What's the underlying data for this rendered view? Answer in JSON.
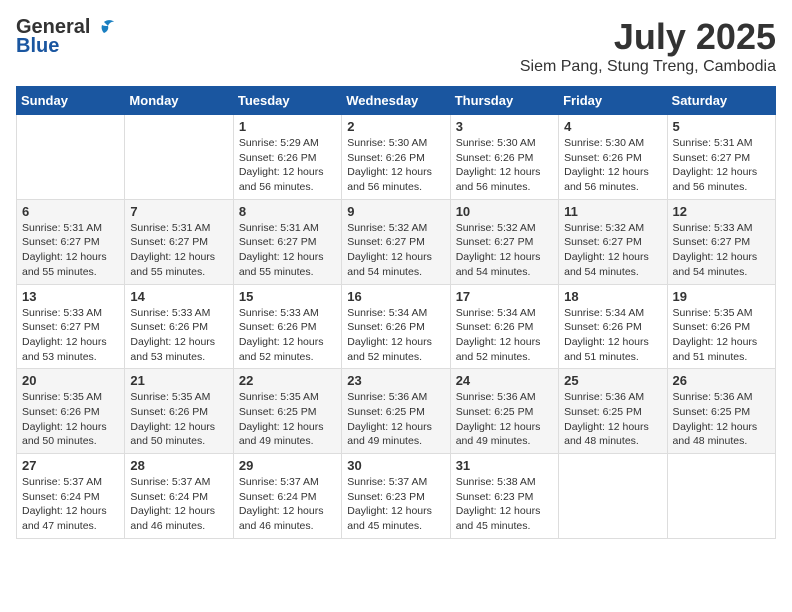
{
  "header": {
    "logo_general": "General",
    "logo_blue": "Blue",
    "title": "July 2025",
    "subtitle": "Siem Pang, Stung Treng, Cambodia"
  },
  "weekdays": [
    "Sunday",
    "Monday",
    "Tuesday",
    "Wednesday",
    "Thursday",
    "Friday",
    "Saturday"
  ],
  "weeks": [
    [
      {
        "day": "",
        "info": ""
      },
      {
        "day": "",
        "info": ""
      },
      {
        "day": "1",
        "info": "Sunrise: 5:29 AM\nSunset: 6:26 PM\nDaylight: 12 hours and 56 minutes."
      },
      {
        "day": "2",
        "info": "Sunrise: 5:30 AM\nSunset: 6:26 PM\nDaylight: 12 hours and 56 minutes."
      },
      {
        "day": "3",
        "info": "Sunrise: 5:30 AM\nSunset: 6:26 PM\nDaylight: 12 hours and 56 minutes."
      },
      {
        "day": "4",
        "info": "Sunrise: 5:30 AM\nSunset: 6:26 PM\nDaylight: 12 hours and 56 minutes."
      },
      {
        "day": "5",
        "info": "Sunrise: 5:31 AM\nSunset: 6:27 PM\nDaylight: 12 hours and 56 minutes."
      }
    ],
    [
      {
        "day": "6",
        "info": "Sunrise: 5:31 AM\nSunset: 6:27 PM\nDaylight: 12 hours and 55 minutes."
      },
      {
        "day": "7",
        "info": "Sunrise: 5:31 AM\nSunset: 6:27 PM\nDaylight: 12 hours and 55 minutes."
      },
      {
        "day": "8",
        "info": "Sunrise: 5:31 AM\nSunset: 6:27 PM\nDaylight: 12 hours and 55 minutes."
      },
      {
        "day": "9",
        "info": "Sunrise: 5:32 AM\nSunset: 6:27 PM\nDaylight: 12 hours and 54 minutes."
      },
      {
        "day": "10",
        "info": "Sunrise: 5:32 AM\nSunset: 6:27 PM\nDaylight: 12 hours and 54 minutes."
      },
      {
        "day": "11",
        "info": "Sunrise: 5:32 AM\nSunset: 6:27 PM\nDaylight: 12 hours and 54 minutes."
      },
      {
        "day": "12",
        "info": "Sunrise: 5:33 AM\nSunset: 6:27 PM\nDaylight: 12 hours and 54 minutes."
      }
    ],
    [
      {
        "day": "13",
        "info": "Sunrise: 5:33 AM\nSunset: 6:27 PM\nDaylight: 12 hours and 53 minutes."
      },
      {
        "day": "14",
        "info": "Sunrise: 5:33 AM\nSunset: 6:26 PM\nDaylight: 12 hours and 53 minutes."
      },
      {
        "day": "15",
        "info": "Sunrise: 5:33 AM\nSunset: 6:26 PM\nDaylight: 12 hours and 52 minutes."
      },
      {
        "day": "16",
        "info": "Sunrise: 5:34 AM\nSunset: 6:26 PM\nDaylight: 12 hours and 52 minutes."
      },
      {
        "day": "17",
        "info": "Sunrise: 5:34 AM\nSunset: 6:26 PM\nDaylight: 12 hours and 52 minutes."
      },
      {
        "day": "18",
        "info": "Sunrise: 5:34 AM\nSunset: 6:26 PM\nDaylight: 12 hours and 51 minutes."
      },
      {
        "day": "19",
        "info": "Sunrise: 5:35 AM\nSunset: 6:26 PM\nDaylight: 12 hours and 51 minutes."
      }
    ],
    [
      {
        "day": "20",
        "info": "Sunrise: 5:35 AM\nSunset: 6:26 PM\nDaylight: 12 hours and 50 minutes."
      },
      {
        "day": "21",
        "info": "Sunrise: 5:35 AM\nSunset: 6:26 PM\nDaylight: 12 hours and 50 minutes."
      },
      {
        "day": "22",
        "info": "Sunrise: 5:35 AM\nSunset: 6:25 PM\nDaylight: 12 hours and 49 minutes."
      },
      {
        "day": "23",
        "info": "Sunrise: 5:36 AM\nSunset: 6:25 PM\nDaylight: 12 hours and 49 minutes."
      },
      {
        "day": "24",
        "info": "Sunrise: 5:36 AM\nSunset: 6:25 PM\nDaylight: 12 hours and 49 minutes."
      },
      {
        "day": "25",
        "info": "Sunrise: 5:36 AM\nSunset: 6:25 PM\nDaylight: 12 hours and 48 minutes."
      },
      {
        "day": "26",
        "info": "Sunrise: 5:36 AM\nSunset: 6:25 PM\nDaylight: 12 hours and 48 minutes."
      }
    ],
    [
      {
        "day": "27",
        "info": "Sunrise: 5:37 AM\nSunset: 6:24 PM\nDaylight: 12 hours and 47 minutes."
      },
      {
        "day": "28",
        "info": "Sunrise: 5:37 AM\nSunset: 6:24 PM\nDaylight: 12 hours and 46 minutes."
      },
      {
        "day": "29",
        "info": "Sunrise: 5:37 AM\nSunset: 6:24 PM\nDaylight: 12 hours and 46 minutes."
      },
      {
        "day": "30",
        "info": "Sunrise: 5:37 AM\nSunset: 6:23 PM\nDaylight: 12 hours and 45 minutes."
      },
      {
        "day": "31",
        "info": "Sunrise: 5:38 AM\nSunset: 6:23 PM\nDaylight: 12 hours and 45 minutes."
      },
      {
        "day": "",
        "info": ""
      },
      {
        "day": "",
        "info": ""
      }
    ]
  ]
}
